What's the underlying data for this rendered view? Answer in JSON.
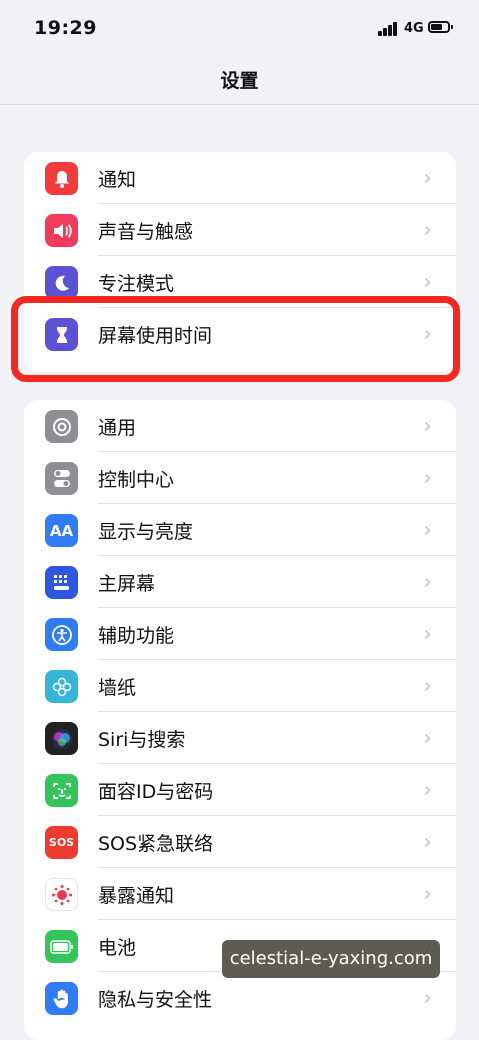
{
  "status": {
    "time": "19:29",
    "network": "4G"
  },
  "nav": {
    "title": "设置"
  },
  "group1": [
    {
      "label": "通知",
      "icon": "bell-icon",
      "color": "#f43b3b"
    },
    {
      "label": "声音与触感",
      "icon": "speaker-icon",
      "color": "#f23b5a"
    },
    {
      "label": "专注模式",
      "icon": "moon-icon",
      "color": "#5b52d6"
    },
    {
      "label": "屏幕使用时间",
      "icon": "hourglass-icon",
      "color": "#5b52d6"
    }
  ],
  "group2": [
    {
      "label": "通用",
      "icon": "gear-icon",
      "color": "#8e8e93"
    },
    {
      "label": "控制中心",
      "icon": "toggles-icon",
      "color": "#8e8e93"
    },
    {
      "label": "显示与亮度",
      "icon": "text-size-icon",
      "icon_text": "AA",
      "color": "#2f7cf6"
    },
    {
      "label": "主屏幕",
      "icon": "home-grid-icon",
      "color": "#2f55e3"
    },
    {
      "label": "辅助功能",
      "icon": "accessibility-icon",
      "color": "#2f7cf6"
    },
    {
      "label": "墙纸",
      "icon": "flower-icon",
      "color": "#35b5d8"
    },
    {
      "label": "Siri与搜索",
      "icon": "siri-icon",
      "color": "#222"
    },
    {
      "label": "面容ID与密码",
      "icon": "face-id-icon",
      "color": "#33c45a"
    },
    {
      "label": "SOS紧急联络",
      "icon": "sos-icon",
      "icon_text": "SOS",
      "color": "#ef3a30"
    },
    {
      "label": "暴露通知",
      "icon": "exposure-icon",
      "color": "#ffffff"
    },
    {
      "label": "电池",
      "icon": "battery-icon",
      "color": "#33c45a"
    },
    {
      "label": "隐私与安全性",
      "icon": "hand-icon",
      "color": "#2f7cf6"
    }
  ],
  "chevron": "›",
  "watermark": "celestial-e-yaxing.com"
}
